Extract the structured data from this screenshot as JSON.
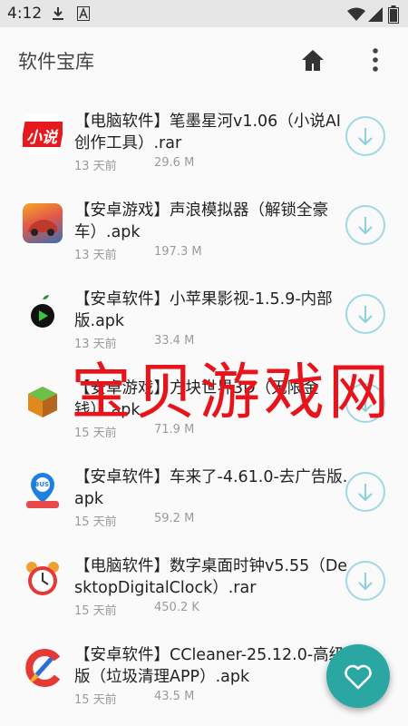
{
  "statusbar": {
    "time": "4:12"
  },
  "appbar": {
    "title": "软件宝库"
  },
  "items": [
    {
      "name": "【电脑软件】笔墨星河v1.06（小说AI创作工具）.rar",
      "age": "13 天前",
      "size": "29.6 M",
      "icon_text": "小说"
    },
    {
      "name": "【安卓游戏】声浪模拟器（解锁全豪车）.apk",
      "age": "13 天前",
      "size": "197.3 M"
    },
    {
      "name": "【安卓软件】小苹果影视-1.5.9-内部版.apk",
      "age": "13 天前",
      "size": "33.4 M"
    },
    {
      "name": "【安卓游戏】方块世界3D（无限金钱）.apk",
      "age": "15 天前",
      "size": "71.9 M"
    },
    {
      "name": "【安卓软件】车来了-4.61.0-去广告版.apk",
      "age": "15 天前",
      "size": "59.2 M",
      "icon_text": "BUS"
    },
    {
      "name": "【电脑软件】数字桌面时钟v5.55（DesktopDigitalClock）.rar",
      "age": "15 天前",
      "size": "450.2 K"
    },
    {
      "name": "【安卓软件】CCleaner-25.12.0-高级版（垃圾清理APP）.apk",
      "age": "15 天前",
      "size": "43.5 M"
    }
  ],
  "watermark": "宝贝游戏网",
  "colors": {
    "accent": "#2aa7a3",
    "download_ring": "#9fd8e4",
    "watermark": "#e8141b"
  }
}
